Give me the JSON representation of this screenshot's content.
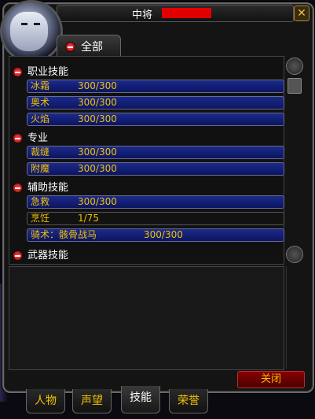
{
  "window": {
    "title": "中将",
    "close_icon": "close-icon",
    "close_button_label": "关闭"
  },
  "header": {
    "tab_label": "全部"
  },
  "skills": [
    {
      "category": "职业技能",
      "items": [
        {
          "name": "冰霜",
          "value": "300/300"
        },
        {
          "name": "奥术",
          "value": "300/300"
        },
        {
          "name": "火焰",
          "value": "300/300"
        }
      ]
    },
    {
      "category": "专业",
      "items": [
        {
          "name": "裁缝",
          "value": "300/300"
        },
        {
          "name": "附魔",
          "value": "300/300"
        }
      ]
    },
    {
      "category": "辅助技能",
      "items": [
        {
          "name": "急救",
          "value": "300/300"
        },
        {
          "name": "烹饪",
          "value": "1/75"
        },
        {
          "name": "骑术：骸骨战马",
          "value": "300/300"
        }
      ]
    },
    {
      "category": "武器技能",
      "items": []
    }
  ],
  "bottom_tabs": [
    "人物",
    "声望",
    "技能",
    "荣誉"
  ],
  "colors": {
    "bar_fill": "#1c2a8a",
    "label": "#f0c000",
    "name_highlight": "#e00000"
  }
}
